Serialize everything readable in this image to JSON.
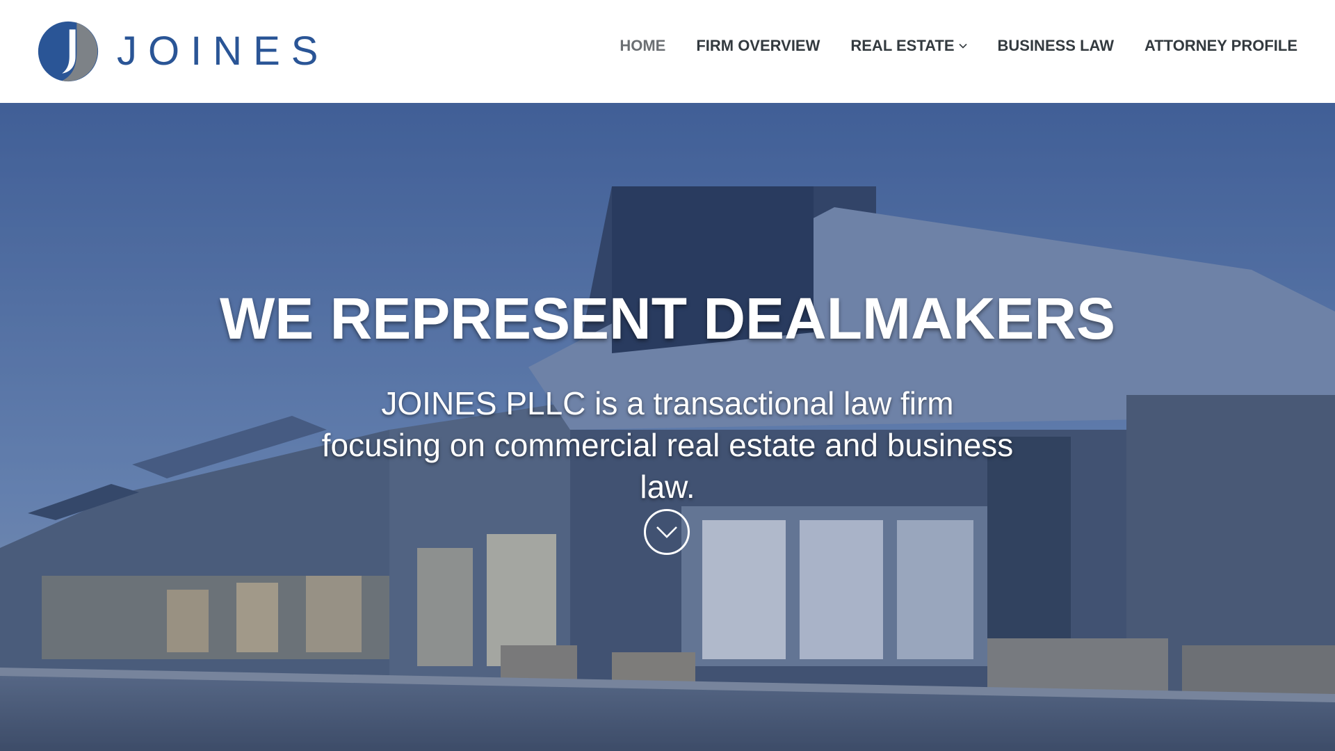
{
  "brand": {
    "name": "JOINES",
    "logo_icon": "logo-j-icon",
    "colors": {
      "primary": "#2a5596",
      "secondary": "#7d8287"
    }
  },
  "nav": {
    "items": [
      {
        "label": "HOME",
        "active": true
      },
      {
        "label": "FIRM OVERVIEW",
        "active": false
      },
      {
        "label": "REAL ESTATE",
        "active": false,
        "has_dropdown": true
      },
      {
        "label": "BUSINESS LAW",
        "active": false
      },
      {
        "label": "ATTORNEY PROFILE",
        "active": false
      }
    ]
  },
  "hero": {
    "title": "WE REPRESENT DEALMAKERS",
    "subtitle": "JOINES PLLC is a transactional law firm focusing on commercial real estate and business law.",
    "scroll_icon": "chevron-down-circle-icon"
  }
}
